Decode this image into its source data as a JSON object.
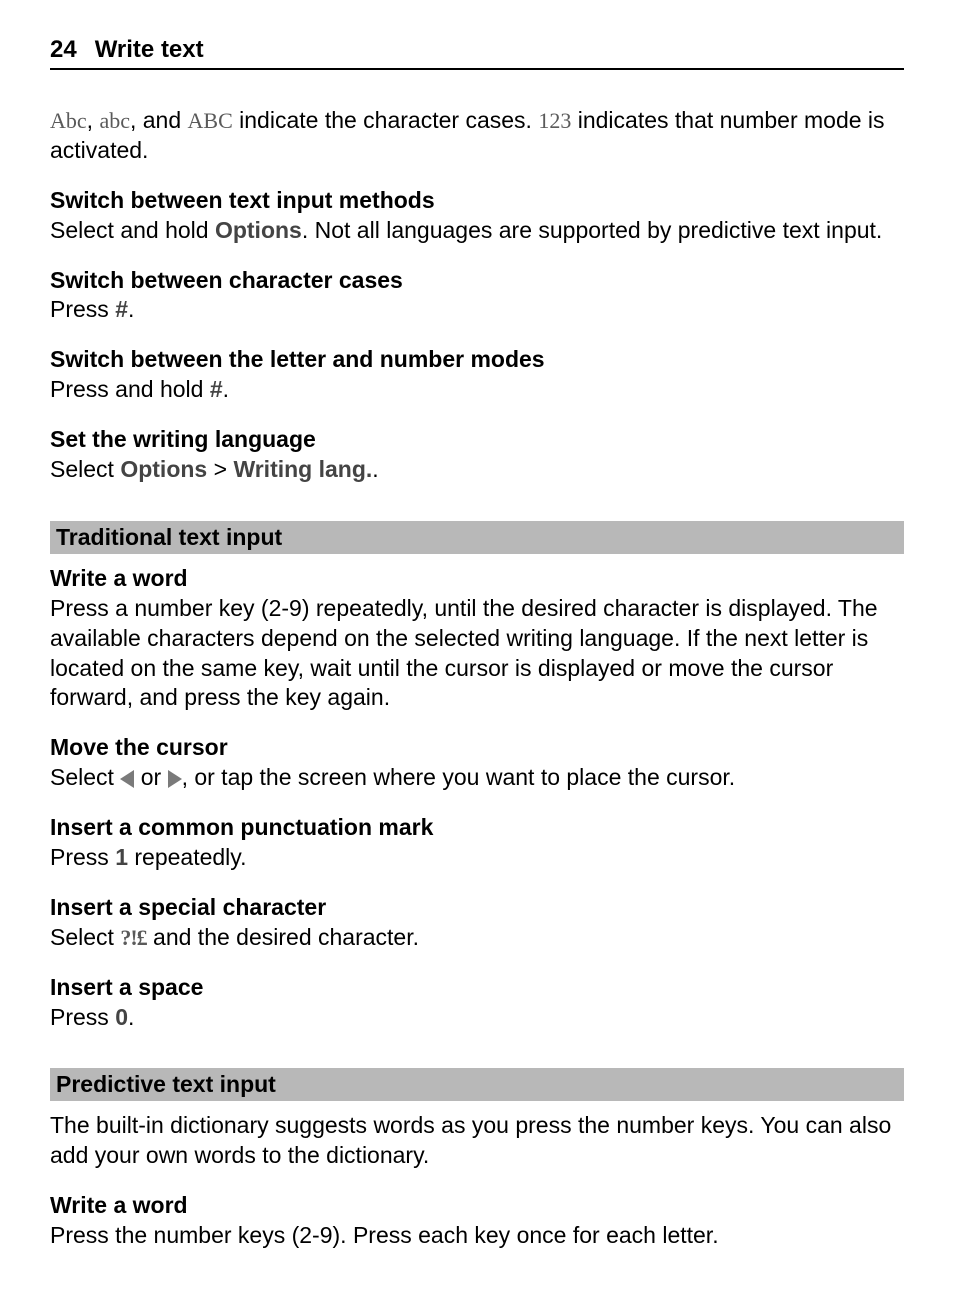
{
  "header": {
    "page_number": "24",
    "title": "Write text"
  },
  "intro": {
    "icon1": "Abc",
    "sep1": ", ",
    "icon2": "abc",
    "sep2": ", ",
    "text1": " and ",
    "icon3": "ABC",
    "text2": " indicate the character cases. ",
    "icon4": "123",
    "text3": " indicates that number mode is activated."
  },
  "sections": [
    {
      "title": "Switch between text input methods",
      "body_pre": "Select and hold ",
      "bold1": "Options",
      "body_post": ". Not all languages are supported by predictive text input."
    },
    {
      "title": "Switch between character cases",
      "body_pre": "Press ",
      "bold1": "#",
      "body_post": "."
    },
    {
      "title": "Switch between the letter and number modes",
      "body_pre": "Press and hold ",
      "bold1": "#",
      "body_post": "."
    },
    {
      "title": "Set the writing language",
      "body_pre": "Select ",
      "bold1": "Options",
      "mid": "  > ",
      "bold2": "Writing lang.",
      "body_post": "."
    }
  ],
  "traditional": {
    "bar": "Traditional text input",
    "write_word_title": "Write a word",
    "write_word_body": "Press a number key (2-9) repeatedly, until the desired character is displayed. The available characters depend on the selected writing language. If the next letter is located on the same key, wait until the cursor is displayed or move the cursor forward, and press the key again.",
    "move_cursor_title": "Move the cursor",
    "move_cursor_pre": "Select ",
    "move_cursor_mid": " or ",
    "move_cursor_post": ", or tap the screen where you want to place the cursor.",
    "punct_title": "Insert a common punctuation mark",
    "punct_pre": "Press ",
    "punct_bold": "1",
    "punct_post": " repeatedly.",
    "special_title": "Insert a special character",
    "special_pre": "Select ",
    "special_icon": "?!£",
    "special_post": " and the desired character.",
    "space_title": "Insert a space",
    "space_pre": "Press ",
    "space_bold": "0",
    "space_post": "."
  },
  "predictive": {
    "bar": "Predictive text input",
    "intro": "The built-in dictionary suggests words as you press the number keys. You can also add your own words to the dictionary.",
    "write_word_title": "Write a word",
    "write_word_body": "Press the number keys (2-9). Press each key once for each letter."
  }
}
